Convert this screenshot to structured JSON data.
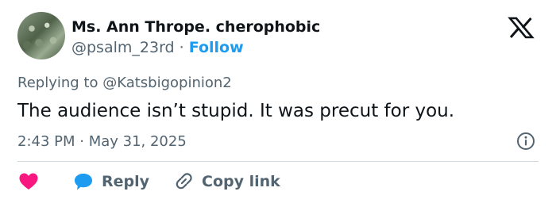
{
  "author": {
    "display_name": "Ms. Ann Thrope. cherophobic",
    "handle": "@psalm_23rd",
    "separator": "·",
    "follow_label": "Follow"
  },
  "reply_context": {
    "prefix": "Replying to",
    "target_handle": "@Katsbigopinion2"
  },
  "tweet": {
    "text": "The audience isn’t stupid. It was precut for you.",
    "timestamp": "2:43 PM · May 31, 2025"
  },
  "actions": {
    "like_icon": "heart-icon",
    "reply_label": "Reply",
    "copy_link_label": "Copy link"
  },
  "colors": {
    "accent": "#1d9bf0",
    "like": "#f91880",
    "text_primary": "#0f1419",
    "text_secondary": "#536471"
  }
}
